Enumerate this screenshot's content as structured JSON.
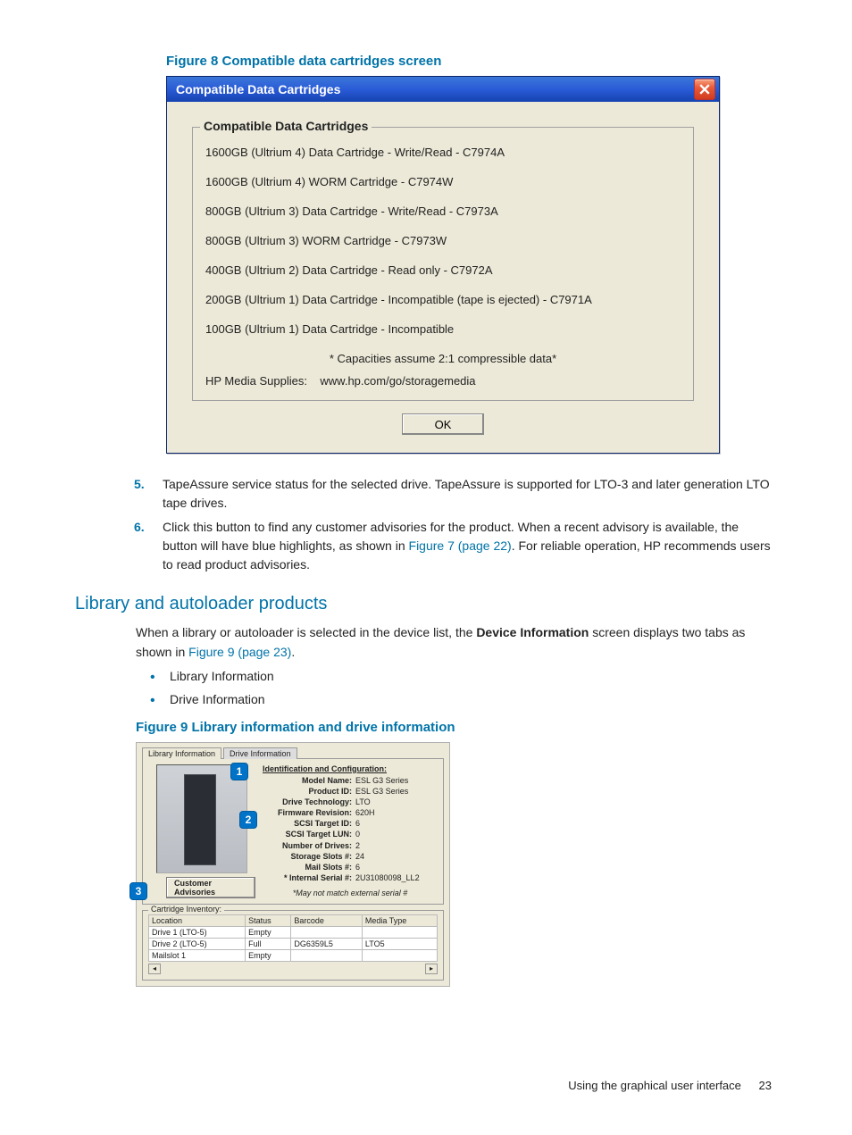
{
  "figure8": {
    "caption": "Figure 8 Compatible data cartridges screen",
    "dialog": {
      "title": "Compatible Data Cartridges",
      "group_legend": "Compatible Data Cartridges",
      "items": [
        "1600GB (Ultrium 4) Data Cartridge - Write/Read - C7974A",
        "1600GB (Ultrium 4) WORM Cartridge - C7974W",
        "800GB (Ultrium 3) Data Cartridge - Write/Read - C7973A",
        "800GB (Ultrium 3) WORM Cartridge - C7973W",
        "400GB (Ultrium 2) Data Cartridge - Read only - C7972A",
        "200GB (Ultrium 1) Data Cartridge - Incompatible (tape is ejected) - C7971A",
        "100GB (Ultrium 1) Data Cartridge - Incompatible"
      ],
      "footnote": "* Capacities assume 2:1 compressible data*",
      "supplies_label": "HP Media Supplies:",
      "supplies_url": "www.hp.com/go/storagemedia",
      "ok": "OK"
    }
  },
  "list": {
    "item5": {
      "num": "5.",
      "text": "TapeAssure service status for the selected drive. TapeAssure is supported for LTO-3 and later generation LTO tape drives."
    },
    "item6": {
      "num": "6.",
      "text_a": "Click this button to find any customer advisories for the product. When a recent advisory is available, the button will have blue highlights, as shown in ",
      "link": "Figure 7 (page 22)",
      "text_b": ". For reliable operation, HP recommends users to read product advisories."
    }
  },
  "section": {
    "heading": "Library and autoloader products",
    "para_a": "When a library or autoloader is selected in the device list, the ",
    "para_bold": "Device Information",
    "para_b": " screen displays two tabs as shown in ",
    "para_link": "Figure 9 (page 23)",
    "para_c": ".",
    "bullets": [
      "Library Information",
      "Drive Information"
    ]
  },
  "figure9": {
    "caption": "Figure 9 Library information and drive information",
    "tabs": {
      "active": "Library Information",
      "inactive": "Drive Information"
    },
    "id_header": "Identification and Configuration:",
    "kv": [
      {
        "k": "Model Name:",
        "v": "ESL G3 Series"
      },
      {
        "k": "Product ID:",
        "v": "ESL G3 Series"
      },
      {
        "k": "Drive Technology:",
        "v": "LTO"
      },
      {
        "k": "Firmware Revision:",
        "v": "620H"
      },
      {
        "k": "SCSI Target ID:",
        "v": "6"
      },
      {
        "k": "SCSI Target LUN:",
        "v": "0"
      },
      {
        "k": "Number of Drives:",
        "v": "2"
      },
      {
        "k": "Storage Slots #:",
        "v": "24"
      },
      {
        "k": "Mail Slots #:",
        "v": "6"
      },
      {
        "k": "* Internal Serial #:",
        "v": "2U31080098_LL2"
      }
    ],
    "serial_note": "*May not match external serial #",
    "advisories_btn": "Customer Advisories",
    "inventory_legend": "Cartridge Inventory:",
    "inv_headers": [
      "Location",
      "Status",
      "Barcode",
      "Media Type"
    ],
    "inv_rows": [
      {
        "loc": "Drive 1 (LTO-5)",
        "status": "Empty",
        "barcode": "",
        "media": ""
      },
      {
        "loc": "Drive 2 (LTO-5)",
        "status": "Full",
        "barcode": "DG6359L5",
        "media": "LTO5"
      },
      {
        "loc": "Mailslot 1",
        "status": "Empty",
        "barcode": "",
        "media": ""
      }
    ],
    "callouts": {
      "c1": "1",
      "c2": "2",
      "c3": "3"
    }
  },
  "footer": {
    "text": "Using the graphical user interface",
    "page": "23"
  }
}
